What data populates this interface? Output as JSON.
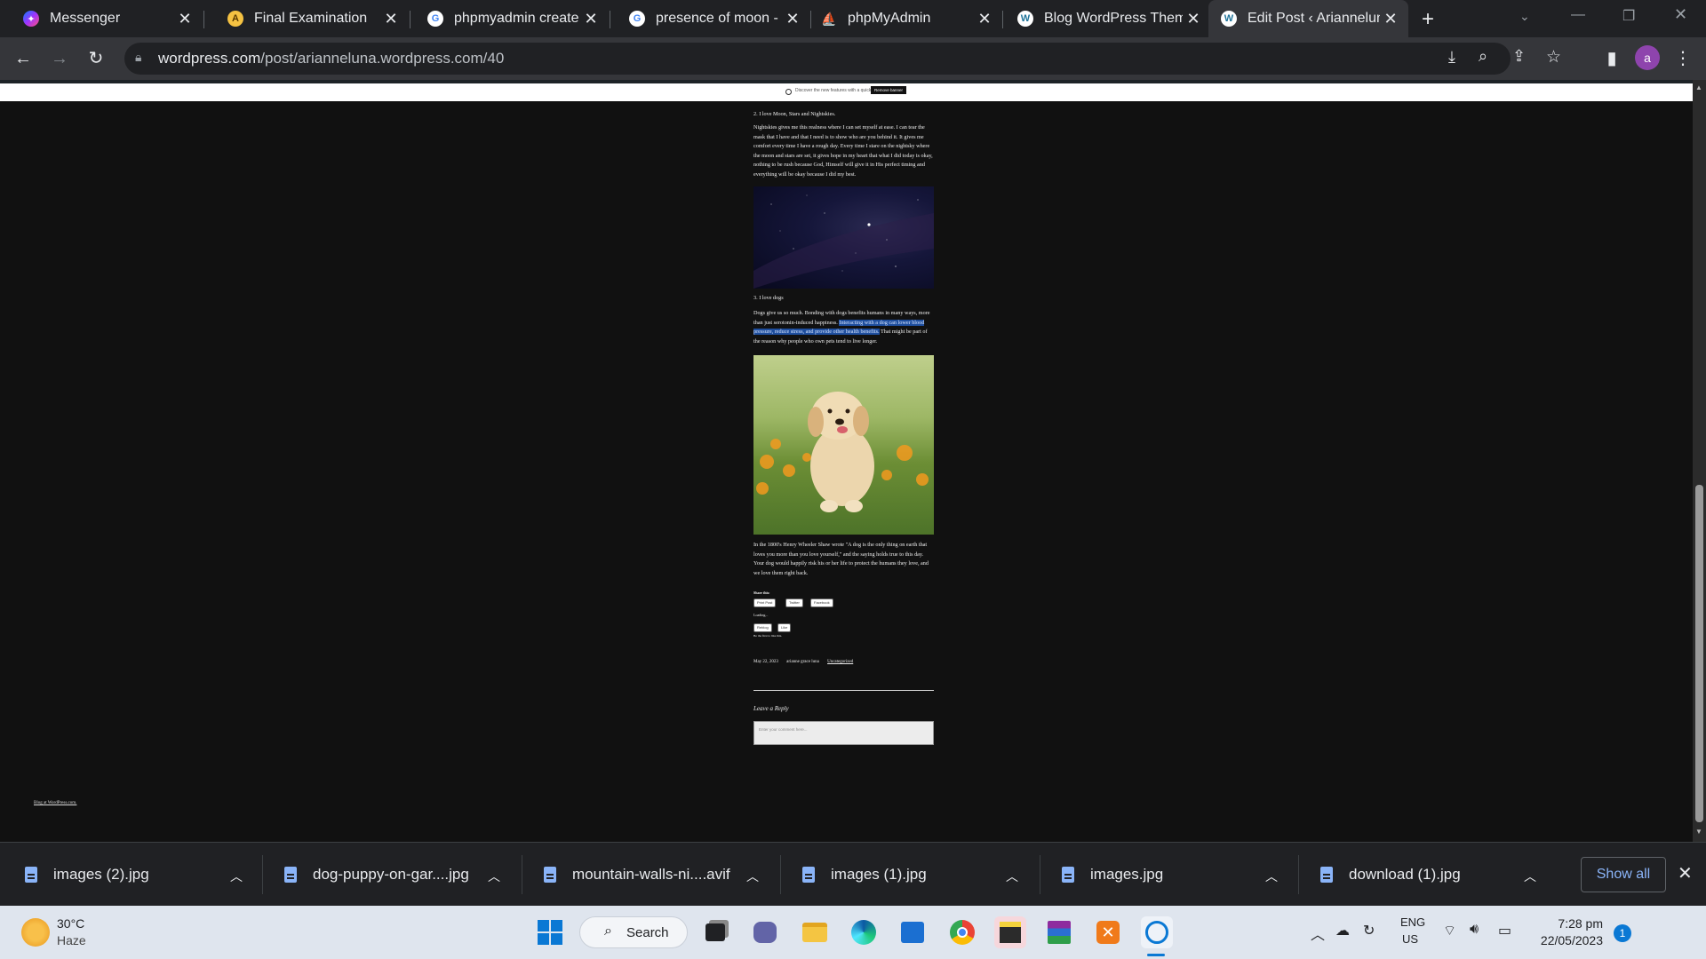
{
  "browser": {
    "tabs": [
      {
        "label": "Messenger",
        "icon": "messenger-icon",
        "active": false
      },
      {
        "label": "Final Examination",
        "icon": "exam-site-icon",
        "active": false
      },
      {
        "label": "phpmyadmin create c",
        "icon": "google-icon",
        "active": false
      },
      {
        "label": "presence of moon - G",
        "icon": "google-icon",
        "active": false
      },
      {
        "label": "phpMyAdmin",
        "icon": "phpmyadmin-icon",
        "active": false
      },
      {
        "label": "Blog WordPress Them",
        "icon": "wordpress-icon",
        "active": false
      },
      {
        "label": "Edit Post ‹ Ariannelun",
        "icon": "wordpress-icon",
        "active": true
      }
    ],
    "new_tab": "+",
    "url_host": "wordpress.com",
    "url_path": "/post/arianneluna.wordpress.com/40",
    "profile_initial": "a"
  },
  "page": {
    "banner_text": "Discover the new features with a quick tour",
    "banner_button": "Remove banner",
    "section2_heading": "2. I love Moon, Stars and Nightskies.",
    "section2_text": "Nightskies gives me this realness where I can set myself at ease. I can tear the mask that I have and that I need is to show who are you behind it. It gives me comfort every time I have a rough day. Every time I stare on the nightsky where the moon and stars are set, it gives hope in my heart that what I did today is okay, nothing to be rush because God, Himself will give it in His perfect timing and everything will be okay because I did my best.",
    "section3_heading": "3. I love dogs",
    "section3_text_a": "Dogs give us so much. Bonding with dogs benefits humans in many ways, more than just serotonin-induced happiness. ",
    "section3_text_hl": "Interacting with a dog can lower blood pressure, reduce stress, and provide other health benefits.",
    "section3_text_b": " That might be part of the reason why people who own pets tend to live longer.",
    "quote_text": "In the 1800's Henry Wheeler Shaw wrote \"A dog is the only thing on earth that loves you more than you love yourself,\" and the saying holds true to this day. Your dog would happily risk his or her life to protect the humans they love, and we love them right back.",
    "share_label": "Share this:",
    "share_buttons": [
      "Print Post",
      "Twitter",
      "Facebook"
    ],
    "like_label": "Loading...",
    "reblog_buttons": [
      "Reblog",
      "Like"
    ],
    "like_first": "Be the first to like this.",
    "post_date": "May 22, 2023",
    "post_author": "arianne grace luna",
    "post_category": "Uncategorized",
    "reply_heading": "Leave a Reply",
    "comment_placeholder": "Enter your comment here...",
    "footer_link": "Blog at WordPress.com."
  },
  "downloads": {
    "items": [
      "images (2).jpg",
      "dog-puppy-on-gar....jpg",
      "mountain-walls-ni....avif",
      "images (1).jpg",
      "images.jpg",
      "download (1).jpg"
    ],
    "show_all": "Show all"
  },
  "taskbar": {
    "weather_temp": "30°C",
    "weather_desc": "Haze",
    "search_label": "Search",
    "lang_top": "ENG",
    "lang_bottom": "US",
    "time": "7:28 pm",
    "date": "22/05/2023",
    "notif_count": "1"
  }
}
